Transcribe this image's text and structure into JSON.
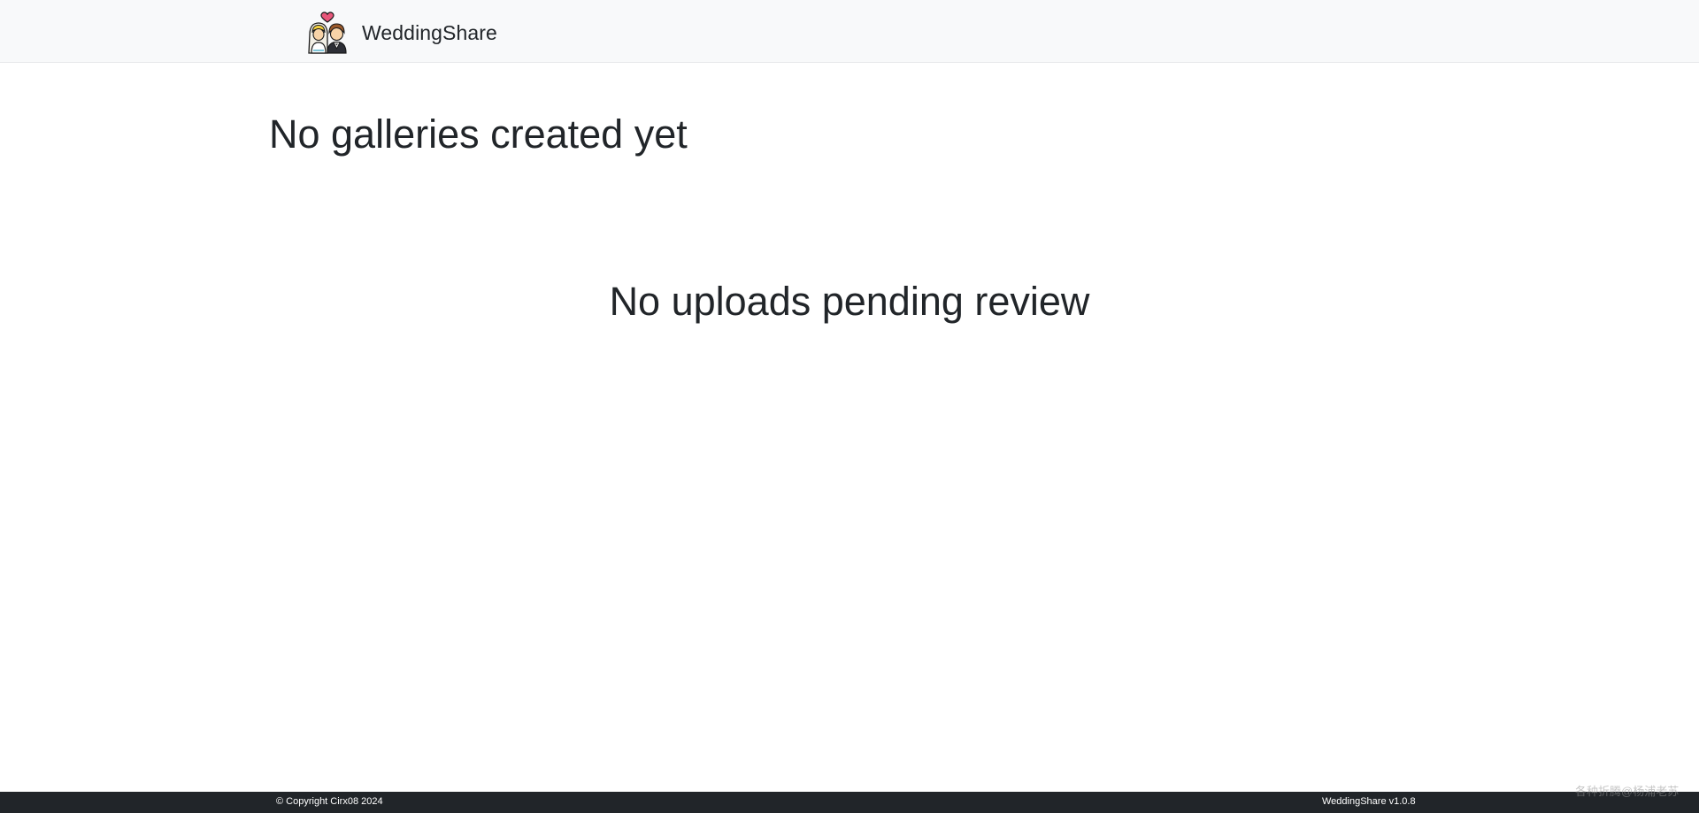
{
  "navbar": {
    "brand_name": "WeddingShare",
    "brand_logo_icon": "bride-and-groom-icon",
    "background": "#f8f9fa"
  },
  "main": {
    "galleries_empty_message": "No galleries created yet",
    "uploads_empty_message": "No uploads pending review"
  },
  "footer": {
    "copyright": "© Copyright Cirx08 2024",
    "version": "WeddingShare v1.0.8",
    "background": "#212529"
  },
  "watermark": {
    "text": "各种折腾@杨浦老苏"
  }
}
